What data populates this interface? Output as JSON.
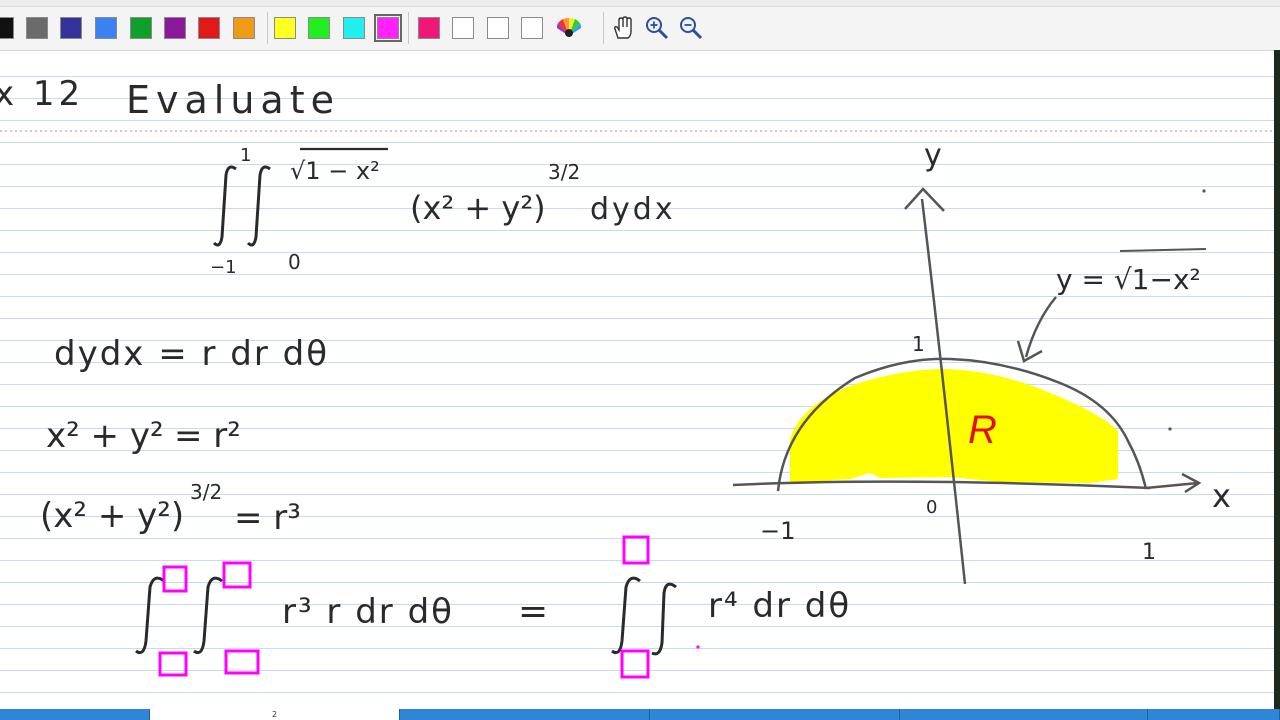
{
  "toolbar": {
    "colors": [
      {
        "name": "black",
        "hex": "#111111"
      },
      {
        "name": "gray",
        "hex": "#6b6b6b"
      },
      {
        "name": "navy",
        "hex": "#33339a"
      },
      {
        "name": "blue",
        "hex": "#3b82f0"
      },
      {
        "name": "green",
        "hex": "#0f9f2a"
      },
      {
        "name": "purple",
        "hex": "#8a1a9a"
      },
      {
        "name": "red",
        "hex": "#e01919"
      },
      {
        "name": "orange",
        "hex": "#f09a1a"
      },
      {
        "name": "yellow",
        "hex": "#ffff22"
      },
      {
        "name": "lime",
        "hex": "#22ee22"
      },
      {
        "name": "cyan",
        "hex": "#22eeee"
      },
      {
        "name": "magenta",
        "hex": "#ff22ff"
      },
      {
        "name": "pink",
        "hex": "#f01877"
      },
      {
        "name": "white-1",
        "hex": "#ffffff"
      },
      {
        "name": "white-2",
        "hex": "#ffffff"
      },
      {
        "name": "white-3",
        "hex": "#ffffff"
      }
    ],
    "selected_color": "magenta",
    "tools": [
      "color-wheel-icon",
      "hand-icon",
      "zoom-in-icon",
      "zoom-out-icon"
    ]
  },
  "notes": {
    "heading_left": "x 12",
    "heading_word": "Evaluate",
    "integral": {
      "outer_lower": "−1",
      "outer_upper": "1",
      "inner_lower": "0",
      "inner_upper": "√1 − x²",
      "integrand": "(x² + y²)",
      "exponent": "3/2",
      "differentials": "dydx"
    },
    "line1": "dydx = r dr dθ",
    "line2_lhs": "x² + y²",
    "line2_rhs": "= r²",
    "line3_lhs": "(x² + y²)",
    "line3_exp": "3/2",
    "line3_rhs": "= r³",
    "line4_left": "r³  r dr dθ",
    "line4_eq": "=",
    "line4_right": "r⁴ dr dθ"
  },
  "graph": {
    "y_axis_label": "y",
    "x_axis_label": "x",
    "curve_label": "y = √1−x²",
    "region_label": "R",
    "tick_top": "1",
    "tick_origin": "0",
    "tick_left": "−1",
    "tick_right": "1",
    "region_color": "#ffff00",
    "region_label_color": "#e01010"
  },
  "tabs": [
    {
      "label": ""
    },
    {
      "label": "2"
    },
    {
      "label": ""
    },
    {
      "label": ""
    },
    {
      "label": ""
    },
    {
      "label": ""
    }
  ]
}
